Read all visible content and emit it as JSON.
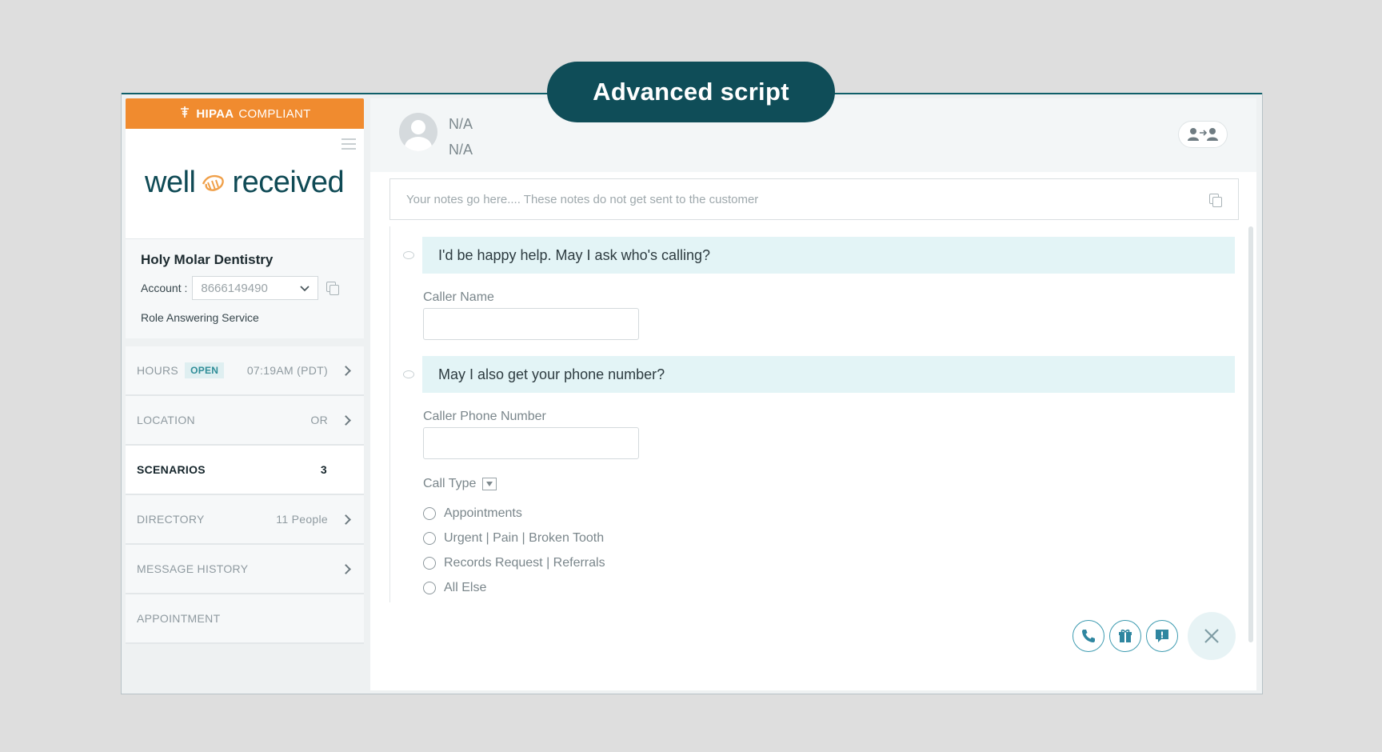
{
  "banner": {
    "title": "Advanced script"
  },
  "sidebar": {
    "hipaa_bold": "HIPAA",
    "hipaa_rest": "COMPLIANT",
    "logo_left": "well",
    "logo_right": "received",
    "business_name": "Holy Molar Dentistry",
    "account_label": "Account :",
    "account_value": "8666149490",
    "role": "Role Answering Service",
    "nav": [
      {
        "label": "HOURS",
        "badge": "OPEN",
        "value": "07:19AM (PDT)"
      },
      {
        "label": "LOCATION",
        "value": "OR"
      },
      {
        "label": "SCENARIOS",
        "value": "3"
      },
      {
        "label": "DIRECTORY",
        "value": "11 People"
      },
      {
        "label": "MESSAGE HISTORY"
      },
      {
        "label": "APPOINTMENT"
      }
    ]
  },
  "header": {
    "caller_name": "N/A",
    "caller_number": "N/A"
  },
  "notes": {
    "placeholder": "Your notes go here.... These notes do not get sent to the customer"
  },
  "script": {
    "prompt1": "I'd be happy help. May I ask who's calling?",
    "field1_label": "Caller Name",
    "field1_value": "",
    "prompt2": "May I also get your phone number?",
    "field2_label": "Caller Phone Number",
    "field2_value": "",
    "call_type_label": "Call Type",
    "options": [
      "Appointments",
      "Urgent | Pain | Broken Tooth",
      "Records Request | Referrals",
      "All Else"
    ]
  },
  "colors": {
    "accent": "#0f4d58",
    "hipaa": "#f08b2f",
    "bubble": "#e3f4f6",
    "action": "#3d9bb0"
  },
  "icons": [
    "menu-icon",
    "copy-icon",
    "chevron-right-icon",
    "transfer-icon",
    "phone-icon",
    "gift-icon",
    "message-icon",
    "close-icon"
  ]
}
